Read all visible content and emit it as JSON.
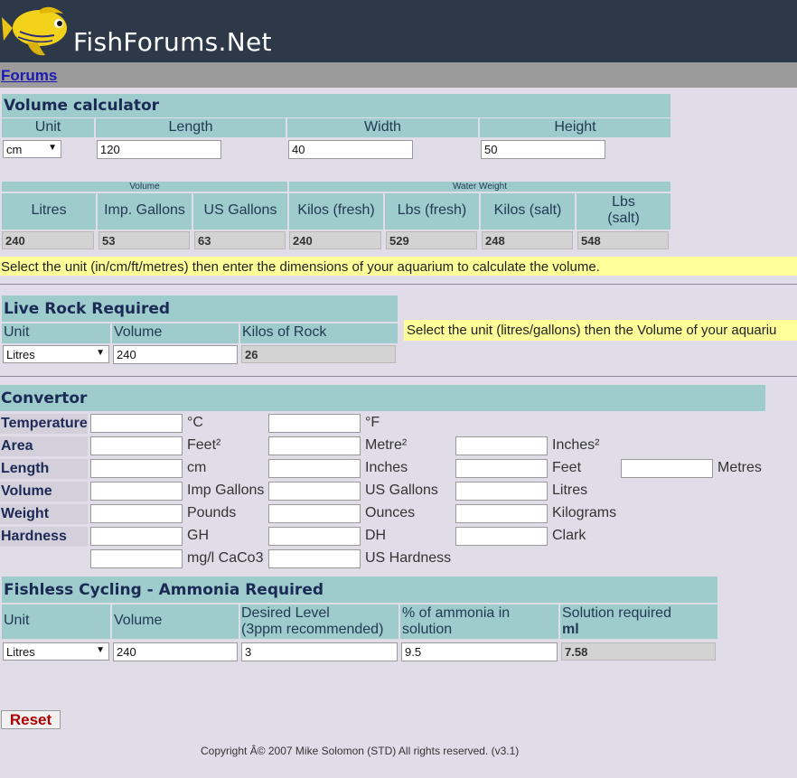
{
  "header": {
    "site_title": "FishForums.Net",
    "logo_icon": "yellow-fish-logo-icon"
  },
  "nav": {
    "forums_link": "Forums"
  },
  "volume_calc": {
    "title": "Volume calculator",
    "col_unit": "Unit",
    "col_length": "Length",
    "col_width": "Width",
    "col_height": "Height",
    "unit_value": "cm",
    "length_value": "120",
    "width_value": "40",
    "height_value": "50",
    "group_volume": "Volume",
    "group_weight": "Water Weight",
    "out_headers": [
      "Litres",
      "Imp. Gallons",
      "US Gallons",
      "Kilos (fresh)",
      "Lbs (fresh)",
      "Kilos (salt)",
      "Lbs\n(salt)"
    ],
    "out_values": [
      "240",
      "53",
      "63",
      "240",
      "529",
      "248",
      "548"
    ],
    "note": "Select the unit (in/cm/ft/metres) then enter the dimensions of your aquarium to calculate the volume."
  },
  "live_rock": {
    "title": "Live Rock Required",
    "col_unit": "Unit",
    "col_volume": "Volume",
    "col_kilos": "Kilos of Rock",
    "unit_value": "Litres",
    "volume_value": "240",
    "kilos_value": "26",
    "note": "Select the unit (litres/gallons) then the Volume of your aquariu"
  },
  "convertor": {
    "title": "Convertor",
    "rows": [
      {
        "label": "Temperature",
        "units": [
          "°C",
          "°F"
        ]
      },
      {
        "label": "Area",
        "units": [
          "Feet²",
          "Metre²",
          "Inches²"
        ]
      },
      {
        "label": "Length",
        "units": [
          "cm",
          "Inches",
          "Feet",
          "Metres"
        ]
      },
      {
        "label": "Volume",
        "units": [
          "Imp Gallons",
          "US Gallons",
          "Litres"
        ]
      },
      {
        "label": "Weight",
        "units": [
          "Pounds",
          "Ounces",
          "Kilograms"
        ]
      },
      {
        "label": "Hardness",
        "units": [
          "GH",
          "DH",
          "Clark"
        ]
      },
      {
        "label": "",
        "units": [
          "mg/l CaCo3",
          "US Hardness"
        ]
      }
    ]
  },
  "fishless": {
    "title": "Fishless Cycling - Ammonia Required",
    "col_unit": "Unit",
    "col_volume": "Volume",
    "col_level_1": "Desired Level",
    "col_level_2": "(3ppm recommended)",
    "col_pct_1": "% of ammonia in",
    "col_pct_2": "solution",
    "col_sol_1": "Solution required",
    "col_sol_2": "ml",
    "unit_value": "Litres",
    "volume_value": "240",
    "level_value": "3",
    "pct_value": "9.5",
    "sol_value": "7.58"
  },
  "reset_label": "Reset",
  "copyright": "Copyright Â© 2007 Mike Solomon (STD) All rights reserved. (v3.1)",
  "colors": {
    "header_bg": "#2d3848",
    "teal": "#9ecbcc",
    "note_bg": "#ffff99",
    "page_bg": "#e0dde8"
  }
}
